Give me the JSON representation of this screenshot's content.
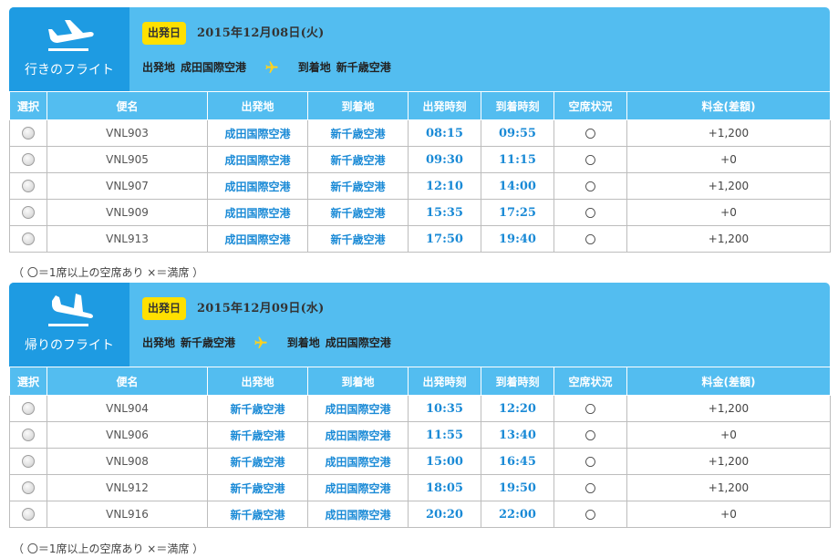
{
  "outbound": {
    "title": "行きのフライト",
    "badge": "出発日",
    "date": "2015年12月08日(火)",
    "dep_label": "出発地",
    "dep_airport": "成田国際空港",
    "arr_label": "到着地",
    "arr_airport": "新千歳空港",
    "columns": [
      "選択",
      "便名",
      "出発地",
      "到着地",
      "出発時刻",
      "到着時刻",
      "空席状況",
      "料金(差額)"
    ],
    "rows": [
      {
        "flight": "VNL903",
        "from": "成田国際空港",
        "to": "新千歳空港",
        "dep": "08:15",
        "arr": "09:55",
        "seat": "〇",
        "fare": "+1,200"
      },
      {
        "flight": "VNL905",
        "from": "成田国際空港",
        "to": "新千歳空港",
        "dep": "09:30",
        "arr": "11:15",
        "seat": "〇",
        "fare": "+0"
      },
      {
        "flight": "VNL907",
        "from": "成田国際空港",
        "to": "新千歳空港",
        "dep": "12:10",
        "arr": "14:00",
        "seat": "〇",
        "fare": "+1,200"
      },
      {
        "flight": "VNL909",
        "from": "成田国際空港",
        "to": "新千歳空港",
        "dep": "15:35",
        "arr": "17:25",
        "seat": "〇",
        "fare": "+0"
      },
      {
        "flight": "VNL913",
        "from": "成田国際空港",
        "to": "新千歳空港",
        "dep": "17:50",
        "arr": "19:40",
        "seat": "〇",
        "fare": "+1,200"
      }
    ],
    "legend": "（ 〇＝1席以上の空席あり ×＝満席 ）"
  },
  "return": {
    "title": "帰りのフライト",
    "badge": "出発日",
    "date": "2015年12月09日(水)",
    "dep_label": "出発地",
    "dep_airport": "新千歳空港",
    "arr_label": "到着地",
    "arr_airport": "成田国際空港",
    "columns": [
      "選択",
      "便名",
      "出発地",
      "到着地",
      "出発時刻",
      "到着時刻",
      "空席状況",
      "料金(差額)"
    ],
    "rows": [
      {
        "flight": "VNL904",
        "from": "新千歳空港",
        "to": "成田国際空港",
        "dep": "10:35",
        "arr": "12:20",
        "seat": "〇",
        "fare": "+1,200"
      },
      {
        "flight": "VNL906",
        "from": "新千歳空港",
        "to": "成田国際空港",
        "dep": "11:55",
        "arr": "13:40",
        "seat": "〇",
        "fare": "+0"
      },
      {
        "flight": "VNL908",
        "from": "新千歳空港",
        "to": "成田国際空港",
        "dep": "15:00",
        "arr": "16:45",
        "seat": "〇",
        "fare": "+1,200"
      },
      {
        "flight": "VNL912",
        "from": "新千歳空港",
        "to": "成田国際空港",
        "dep": "18:05",
        "arr": "19:50",
        "seat": "〇",
        "fare": "+1,200"
      },
      {
        "flight": "VNL916",
        "from": "新千歳空港",
        "to": "成田国際空港",
        "dep": "20:20",
        "arr": "22:00",
        "seat": "〇",
        "fare": "+0"
      }
    ],
    "legend": "（ 〇＝1席以上の空席あり ×＝満席 ）"
  },
  "colors": {
    "header_dark": "#1e9be2",
    "header_light": "#53bdf0",
    "badge": "#ffe000",
    "accent_text": "#1a8ad6",
    "plane_icon": "#ffd21e"
  },
  "icons": {
    "outbound": "airplane-takeoff-icon",
    "return": "airplane-landing-icon",
    "route": "airplane-icon"
  }
}
